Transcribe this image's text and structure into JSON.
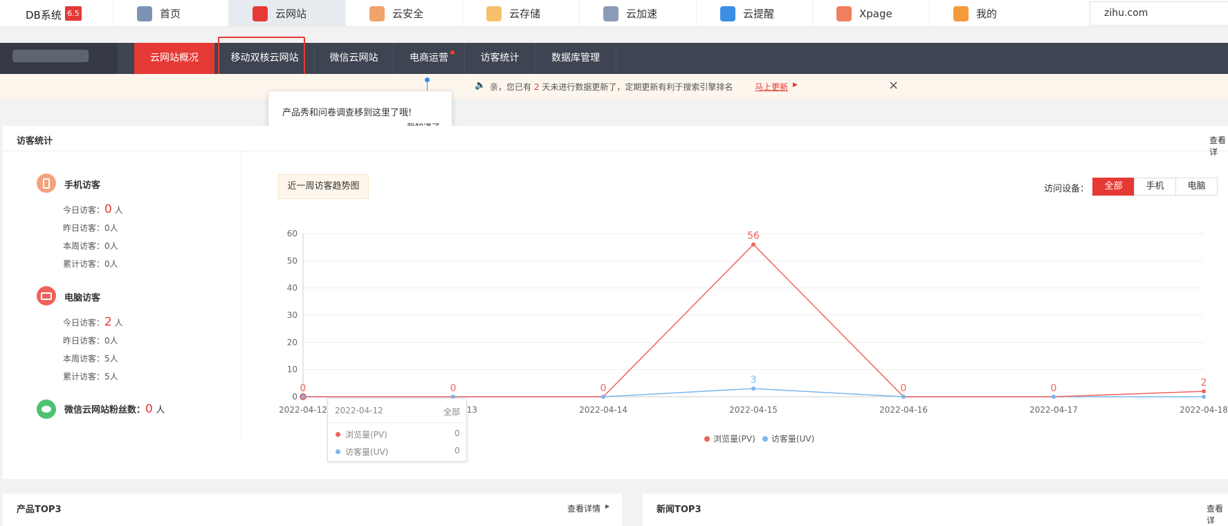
{
  "topbar": {
    "brand": "DB系统",
    "version": "6.5",
    "nav": [
      {
        "label": "首页",
        "icon": "home-icon",
        "color": "#7c93b4"
      },
      {
        "label": "云网站",
        "icon": "cloud-site-icon",
        "color": "#e53935"
      },
      {
        "label": "云安全",
        "icon": "shield-icon",
        "color": "#f0a36b"
      },
      {
        "label": "云存储",
        "icon": "folder-icon",
        "color": "#f5c16b"
      },
      {
        "label": "云加速",
        "icon": "rocket-icon",
        "color": "#8a9bb8"
      },
      {
        "label": "云提醒",
        "icon": "bell-icon",
        "color": "#3a8ee6"
      },
      {
        "label": "Xpage",
        "icon": "xpage-icon",
        "color": "#f07f5d"
      },
      {
        "label": "我的",
        "icon": "user-icon",
        "color": "#f59a3b"
      }
    ],
    "search_value": "zihu.com"
  },
  "subnav": {
    "tabs": [
      "云网站概况",
      "移动双核云网站",
      "微信云网站",
      "电商运营",
      "访客统计",
      "数据库管理"
    ]
  },
  "notice": {
    "prefix": "亲，您已有",
    "days": "2",
    "suffix": "天未进行数据更新了，定期更新有利于搜索引擎排名",
    "link": "马上更新"
  },
  "tooltip": {
    "text": "产品秀和问卷调查移到这里了哦!",
    "ack": "我知道了"
  },
  "visitor_panel": {
    "title": "访客统计",
    "more": "查看详",
    "mobile": {
      "title": "手机访客",
      "today_label": "今日访客：",
      "today_value": "0",
      "unit": "人",
      "yesterday": "昨日访客：0人",
      "week": "本周访客：0人",
      "total": "累计访客：0人"
    },
    "pc": {
      "title": "电脑访客",
      "today_label": "今日访客：",
      "today_value": "2",
      "unit": "人",
      "yesterday": "昨日访客：0人",
      "week": "本周访客：5人",
      "total": "累计访客：5人"
    },
    "wechat": {
      "label": "微信云网站粉丝数：",
      "value": "0",
      "unit": "人"
    },
    "chart_title": "近一周访客趋势图",
    "device_label": "访问设备：",
    "device_options": [
      "全部",
      "手机",
      "电脑"
    ]
  },
  "chart_data": {
    "type": "line",
    "title": "近一周访客趋势图",
    "x": [
      "2022-04-12",
      "2022-04-13",
      "2022-04-14",
      "2022-04-15",
      "2022-04-16",
      "2022-04-17",
      "2022-04-18"
    ],
    "ylim": [
      0,
      60
    ],
    "yticks": [
      0,
      10,
      20,
      30,
      40,
      50,
      60
    ],
    "series": [
      {
        "name": "浏览量(PV)",
        "color": "#f0625d",
        "values": [
          0,
          0,
          0,
          56,
          0,
          0,
          2
        ]
      },
      {
        "name": "访客量(UV)",
        "color": "#7ab8ee",
        "values": [
          0,
          0,
          0,
          3,
          0,
          0,
          0
        ]
      }
    ],
    "legend": "bottom-center",
    "hover_tooltip": {
      "date": "2022-04-12",
      "scope": "全部",
      "rows": [
        {
          "name": "浏览量(PV)",
          "value": "0"
        },
        {
          "name": "访客量(UV)",
          "value": "0"
        }
      ]
    }
  },
  "bottom": {
    "products_title": "产品TOP3",
    "products_more": "查看详情",
    "news_title": "新闻TOP3",
    "news_more": "查看详"
  }
}
